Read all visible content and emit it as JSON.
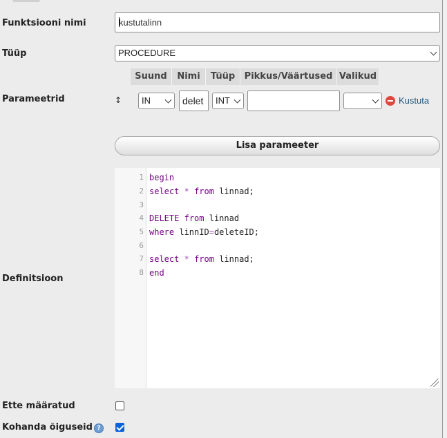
{
  "form": {
    "function_name": {
      "label": "Funktsiooni nimi",
      "value": "kustutalinn"
    },
    "type": {
      "label": "Tüüp",
      "value": "PROCEDURE"
    },
    "parameters": {
      "label": "Parameetrid",
      "headers": [
        "Suund",
        "Nimi",
        "Tüüp",
        "Pikkus/Väärtused",
        "Valikud"
      ],
      "row": {
        "direction": "IN",
        "name": "delet",
        "type": "INT",
        "length": "",
        "options": "",
        "delete_label": "Kustuta"
      },
      "add_button": "Lisa parameeter"
    },
    "definition": {
      "label": "Definitsioon",
      "line_numbers": [
        "1",
        "2",
        "3",
        "4",
        "5",
        "6",
        "7",
        "8"
      ]
    },
    "deterministic": {
      "label": "Ette määratud",
      "checked": false
    },
    "adjust_privileges": {
      "label": "Kohanda õiguseid",
      "checked": true
    }
  },
  "colors": {
    "keyword": "#770088",
    "link": "#235a81",
    "checkbox_checked": "#0f62d6",
    "delete_icon": "#e0463c"
  },
  "icons": [
    "drag-handle-icon",
    "delete-icon",
    "chevron-down-icon",
    "resize-handle-icon",
    "help-icon",
    "checkmark-icon"
  ]
}
